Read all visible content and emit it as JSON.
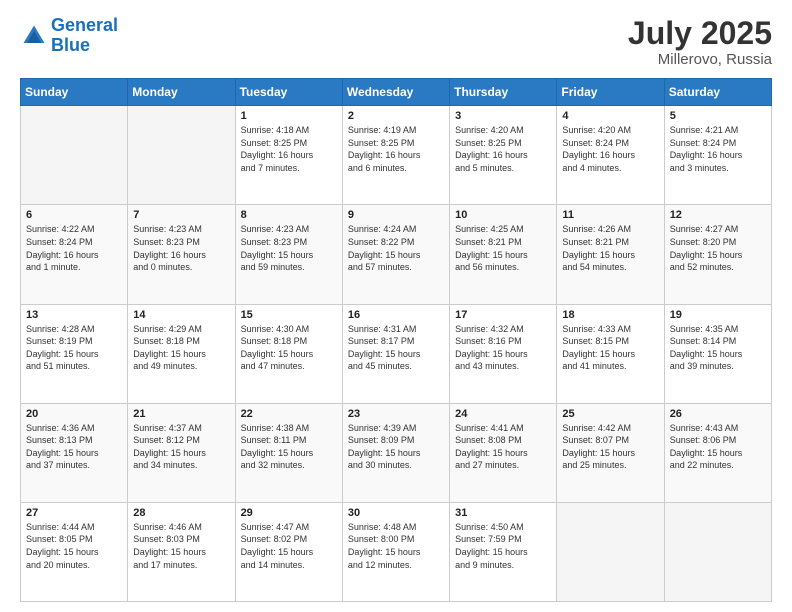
{
  "header": {
    "logo_line1": "General",
    "logo_line2": "Blue",
    "month_year": "July 2025",
    "location": "Millerovo, Russia"
  },
  "weekdays": [
    "Sunday",
    "Monday",
    "Tuesday",
    "Wednesday",
    "Thursday",
    "Friday",
    "Saturday"
  ],
  "weeks": [
    [
      {
        "day": "",
        "info": ""
      },
      {
        "day": "",
        "info": ""
      },
      {
        "day": "1",
        "info": "Sunrise: 4:18 AM\nSunset: 8:25 PM\nDaylight: 16 hours\nand 7 minutes."
      },
      {
        "day": "2",
        "info": "Sunrise: 4:19 AM\nSunset: 8:25 PM\nDaylight: 16 hours\nand 6 minutes."
      },
      {
        "day": "3",
        "info": "Sunrise: 4:20 AM\nSunset: 8:25 PM\nDaylight: 16 hours\nand 5 minutes."
      },
      {
        "day": "4",
        "info": "Sunrise: 4:20 AM\nSunset: 8:24 PM\nDaylight: 16 hours\nand 4 minutes."
      },
      {
        "day": "5",
        "info": "Sunrise: 4:21 AM\nSunset: 8:24 PM\nDaylight: 16 hours\nand 3 minutes."
      }
    ],
    [
      {
        "day": "6",
        "info": "Sunrise: 4:22 AM\nSunset: 8:24 PM\nDaylight: 16 hours\nand 1 minute."
      },
      {
        "day": "7",
        "info": "Sunrise: 4:23 AM\nSunset: 8:23 PM\nDaylight: 16 hours\nand 0 minutes."
      },
      {
        "day": "8",
        "info": "Sunrise: 4:23 AM\nSunset: 8:23 PM\nDaylight: 15 hours\nand 59 minutes."
      },
      {
        "day": "9",
        "info": "Sunrise: 4:24 AM\nSunset: 8:22 PM\nDaylight: 15 hours\nand 57 minutes."
      },
      {
        "day": "10",
        "info": "Sunrise: 4:25 AM\nSunset: 8:21 PM\nDaylight: 15 hours\nand 56 minutes."
      },
      {
        "day": "11",
        "info": "Sunrise: 4:26 AM\nSunset: 8:21 PM\nDaylight: 15 hours\nand 54 minutes."
      },
      {
        "day": "12",
        "info": "Sunrise: 4:27 AM\nSunset: 8:20 PM\nDaylight: 15 hours\nand 52 minutes."
      }
    ],
    [
      {
        "day": "13",
        "info": "Sunrise: 4:28 AM\nSunset: 8:19 PM\nDaylight: 15 hours\nand 51 minutes."
      },
      {
        "day": "14",
        "info": "Sunrise: 4:29 AM\nSunset: 8:18 PM\nDaylight: 15 hours\nand 49 minutes."
      },
      {
        "day": "15",
        "info": "Sunrise: 4:30 AM\nSunset: 8:18 PM\nDaylight: 15 hours\nand 47 minutes."
      },
      {
        "day": "16",
        "info": "Sunrise: 4:31 AM\nSunset: 8:17 PM\nDaylight: 15 hours\nand 45 minutes."
      },
      {
        "day": "17",
        "info": "Sunrise: 4:32 AM\nSunset: 8:16 PM\nDaylight: 15 hours\nand 43 minutes."
      },
      {
        "day": "18",
        "info": "Sunrise: 4:33 AM\nSunset: 8:15 PM\nDaylight: 15 hours\nand 41 minutes."
      },
      {
        "day": "19",
        "info": "Sunrise: 4:35 AM\nSunset: 8:14 PM\nDaylight: 15 hours\nand 39 minutes."
      }
    ],
    [
      {
        "day": "20",
        "info": "Sunrise: 4:36 AM\nSunset: 8:13 PM\nDaylight: 15 hours\nand 37 minutes."
      },
      {
        "day": "21",
        "info": "Sunrise: 4:37 AM\nSunset: 8:12 PM\nDaylight: 15 hours\nand 34 minutes."
      },
      {
        "day": "22",
        "info": "Sunrise: 4:38 AM\nSunset: 8:11 PM\nDaylight: 15 hours\nand 32 minutes."
      },
      {
        "day": "23",
        "info": "Sunrise: 4:39 AM\nSunset: 8:09 PM\nDaylight: 15 hours\nand 30 minutes."
      },
      {
        "day": "24",
        "info": "Sunrise: 4:41 AM\nSunset: 8:08 PM\nDaylight: 15 hours\nand 27 minutes."
      },
      {
        "day": "25",
        "info": "Sunrise: 4:42 AM\nSunset: 8:07 PM\nDaylight: 15 hours\nand 25 minutes."
      },
      {
        "day": "26",
        "info": "Sunrise: 4:43 AM\nSunset: 8:06 PM\nDaylight: 15 hours\nand 22 minutes."
      }
    ],
    [
      {
        "day": "27",
        "info": "Sunrise: 4:44 AM\nSunset: 8:05 PM\nDaylight: 15 hours\nand 20 minutes."
      },
      {
        "day": "28",
        "info": "Sunrise: 4:46 AM\nSunset: 8:03 PM\nDaylight: 15 hours\nand 17 minutes."
      },
      {
        "day": "29",
        "info": "Sunrise: 4:47 AM\nSunset: 8:02 PM\nDaylight: 15 hours\nand 14 minutes."
      },
      {
        "day": "30",
        "info": "Sunrise: 4:48 AM\nSunset: 8:00 PM\nDaylight: 15 hours\nand 12 minutes."
      },
      {
        "day": "31",
        "info": "Sunrise: 4:50 AM\nSunset: 7:59 PM\nDaylight: 15 hours\nand 9 minutes."
      },
      {
        "day": "",
        "info": ""
      },
      {
        "day": "",
        "info": ""
      }
    ]
  ]
}
